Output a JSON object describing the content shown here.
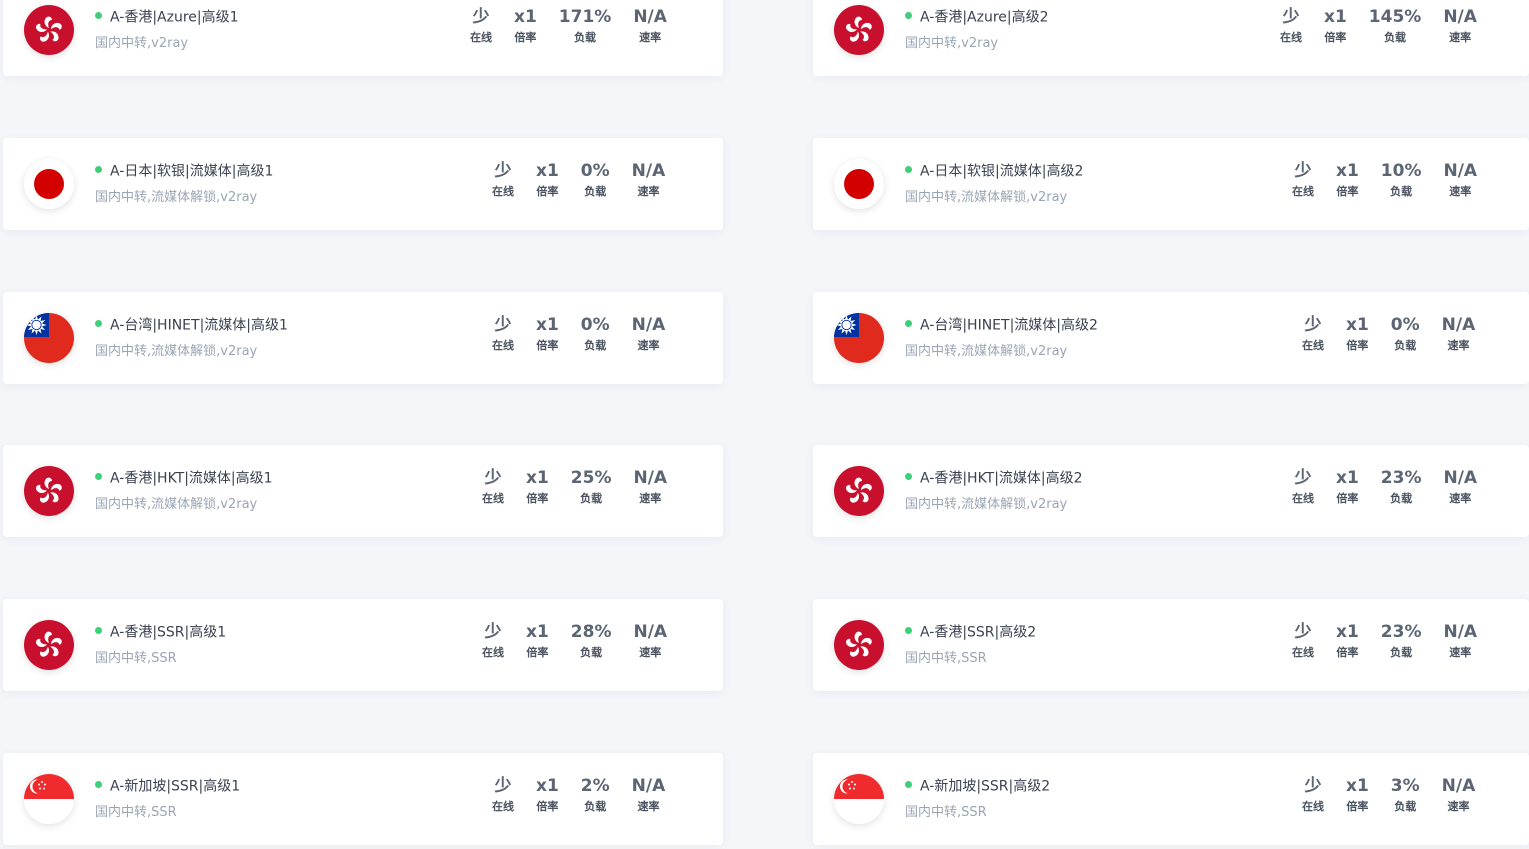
{
  "colors": {
    "online_dot": "#3fcf79",
    "hk_red": "#c8102e",
    "jp_red": "#d30000",
    "tw_blue": "#0033a0",
    "tw_red": "#e02a1d",
    "sg_red": "#ef2b2d"
  },
  "stat_labels": {
    "online": "在线",
    "rate": "倍率",
    "load": "负载",
    "speed": "速率"
  },
  "nodes": [
    {
      "flag": "hongkong-flag-icon",
      "name": "A-香港|Azure|高级1",
      "desc": "国内中转,v2ray",
      "online": "少",
      "rate": "x1",
      "load": "171%",
      "speed": "N/A"
    },
    {
      "flag": "hongkong-flag-icon",
      "name": "A-香港|Azure|高级2",
      "desc": "国内中转,v2ray",
      "online": "少",
      "rate": "x1",
      "load": "145%",
      "speed": "N/A"
    },
    {
      "flag": "japan-flag-icon",
      "name": "A-日本|软银|流媒体|高级1",
      "desc": "国内中转,流媒体解锁,v2ray",
      "online": "少",
      "rate": "x1",
      "load": "0%",
      "speed": "N/A"
    },
    {
      "flag": "japan-flag-icon",
      "name": "A-日本|软银|流媒体|高级2",
      "desc": "国内中转,流媒体解锁,v2ray",
      "online": "少",
      "rate": "x1",
      "load": "10%",
      "speed": "N/A"
    },
    {
      "flag": "taiwan-flag-icon",
      "name": "A-台湾|HINET|流媒体|高级1",
      "desc": "国内中转,流媒体解锁,v2ray",
      "online": "少",
      "rate": "x1",
      "load": "0%",
      "speed": "N/A"
    },
    {
      "flag": "taiwan-flag-icon",
      "name": "A-台湾|HINET|流媒体|高级2",
      "desc": "国内中转,流媒体解锁,v2ray",
      "online": "少",
      "rate": "x1",
      "load": "0%",
      "speed": "N/A"
    },
    {
      "flag": "hongkong-flag-icon",
      "name": "A-香港|HKT|流媒体|高级1",
      "desc": "国内中转,流媒体解锁,v2ray",
      "online": "少",
      "rate": "x1",
      "load": "25%",
      "speed": "N/A"
    },
    {
      "flag": "hongkong-flag-icon",
      "name": "A-香港|HKT|流媒体|高级2",
      "desc": "国内中转,流媒体解锁,v2ray",
      "online": "少",
      "rate": "x1",
      "load": "23%",
      "speed": "N/A"
    },
    {
      "flag": "hongkong-flag-icon",
      "name": "A-香港|SSR|高级1",
      "desc": "国内中转,SSR",
      "online": "少",
      "rate": "x1",
      "load": "28%",
      "speed": "N/A"
    },
    {
      "flag": "hongkong-flag-icon",
      "name": "A-香港|SSR|高级2",
      "desc": "国内中转,SSR",
      "online": "少",
      "rate": "x1",
      "load": "23%",
      "speed": "N/A"
    },
    {
      "flag": "singapore-flag-icon",
      "name": "A-新加坡|SSR|高级1",
      "desc": "国内中转,SSR",
      "online": "少",
      "rate": "x1",
      "load": "2%",
      "speed": "N/A"
    },
    {
      "flag": "singapore-flag-icon",
      "name": "A-新加坡|SSR|高级2",
      "desc": "国内中转,SSR",
      "online": "少",
      "rate": "x1",
      "load": "3%",
      "speed": "N/A"
    }
  ]
}
